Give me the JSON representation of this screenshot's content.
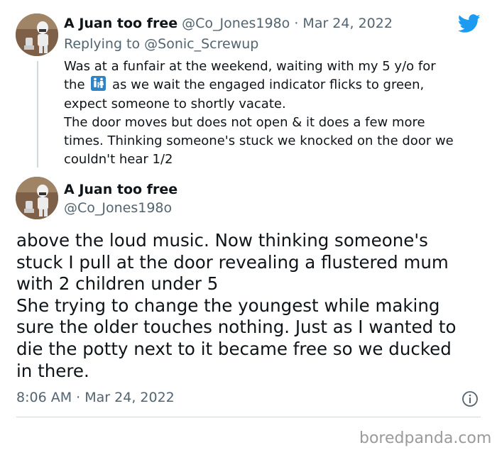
{
  "tweet1": {
    "display_name": "A Juan too free",
    "handle": "@Co_Jones198o",
    "separator": "·",
    "date": "Mar 24, 2022",
    "replying_to_prefix": "Replying to",
    "replying_to_handle": "@Sonic_Screwup",
    "body_lines": [
      "Was at a funfair at the weekend, waiting with my 5 y/o for",
      "as we wait the engaged indicator flicks to green,",
      "expect someone to shortly vacate.",
      "The door moves but does not open & it does a few more",
      "times. Thinking someone's stuck we knocked on the door we",
      "couldn't hear 1/2"
    ],
    "body_line2_prefix": "the",
    "emoji": "family-restroom-icon"
  },
  "tweet2": {
    "display_name": "A Juan too free",
    "handle": "@Co_Jones198o",
    "body_lines": [
      "above the loud music. Now thinking someone's",
      "stuck I pull at the door revealing a flustered mum",
      "with 2 children under 5",
      "She trying to change the youngest while making",
      "sure the older touches nothing. Just as I wanted to",
      "die the potty next to it became free so we ducked",
      "in there."
    ],
    "time": "8:06 AM",
    "separator": "·",
    "date": "Mar 24, 2022"
  },
  "watermark": "boredpanda.com",
  "colors": {
    "text": "#0f1419",
    "muted": "#536471",
    "twitter_blue": "#1d9bf0",
    "divider": "#cfd9de"
  }
}
